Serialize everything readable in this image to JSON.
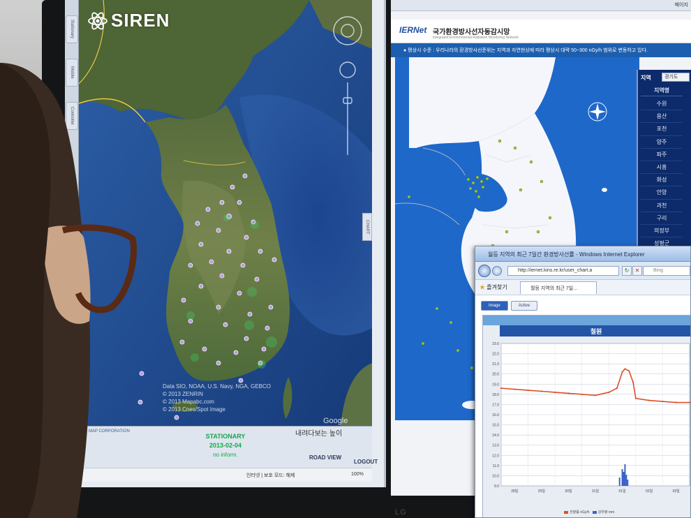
{
  "left_app": {
    "logo": "SIREN",
    "side_tabs": [
      "Stationary",
      "Mobile",
      "Controller"
    ],
    "chart_tab": "CHART",
    "map_credits": [
      "Data SIO, NOAA, U.S. Navy, NGA, GEBCO",
      "© 2013 ZENRIN",
      "© 2013 Mapabc.com",
      "© 2013 Cnes/Spot Image"
    ],
    "map_corner_text": "내려다보는 높이",
    "map_corp": "MAP CORPORATION",
    "status": {
      "title": "STATIONARY",
      "date": "2013-02-04",
      "info": "no inform."
    },
    "road_view": "ROAD VIEW",
    "logout": "LOGOUT",
    "ie_status": {
      "zone": "인터넷 | 보호 모드: 해제",
      "zoom": "100%"
    }
  },
  "right_app": {
    "top_bar_tail": "페이지",
    "logo": "IERNet",
    "title": "국가환경방사선자동감시망",
    "title_en": "Integrated Environmental Radiation Monitoring Network",
    "notice": "● 평상시 수준 : 우리나라의 환경방사선준위는 지역과 자연현상에 따라 평상시 대략 50~300 nGy/h 범위로 변동하고 있다.",
    "region_panel": {
      "heading": "지역",
      "selected": "경기도",
      "column": "지역명",
      "regions": [
        "수원",
        "용산",
        "포천",
        "양주",
        "파주",
        "시흥",
        "화성",
        "안양",
        "과천",
        "구리",
        "의정부",
        "성평군"
      ]
    }
  },
  "ie_window": {
    "title": "월등 지역의 최근 7일간 환경방사선률 - Windows Internet Explorer",
    "url": "http://iernet.kins.re.kr/user_chart.a",
    "search": "Bing",
    "favorites": "즐겨찾기",
    "tab_label": "월등 지역의 최근 7일...",
    "page_tabs": [
      "Image",
      "Active"
    ],
    "chart_title": "철원"
  },
  "chart_data": {
    "type": "line",
    "title": "철원",
    "ylim": [
      9.0,
      23.0
    ],
    "ytick_labels": [
      "23.0",
      "22.0",
      "21.0",
      "20.0",
      "19.0",
      "18.0",
      "17.0",
      "16.0",
      "15.0",
      "14.0",
      "13.0",
      "12.0",
      "11.0",
      "10.0",
      "9.0"
    ],
    "xtick_labels": [
      "28일",
      "29일",
      "30일",
      "31일",
      "01일",
      "02일",
      "03일"
    ],
    "series": [
      {
        "name": "선량률 nGy/h",
        "color": "#d9502a",
        "x": [
          0,
          0.5,
          1,
          1.5,
          2,
          2.5,
          3,
          3.5,
          4,
          4.3,
          4.5,
          4.6,
          4.75,
          4.9,
          5,
          5.5,
          6,
          6.5,
          7
        ],
        "values": [
          18.6,
          18.5,
          18.4,
          18.3,
          18.2,
          18.1,
          18.0,
          17.9,
          18.2,
          18.6,
          20.2,
          20.5,
          20.3,
          19.2,
          17.6,
          17.4,
          17.3,
          17.2,
          17.2
        ]
      },
      {
        "name": "강우량 mm",
        "color": "#3a63c8",
        "bars": [
          {
            "x": 4.4,
            "values": 1.2
          },
          {
            "x": 4.5,
            "values": 2.4
          },
          {
            "x": 4.55,
            "values": 2.0
          },
          {
            "x": 4.6,
            "values": 3.1
          },
          {
            "x": 4.65,
            "values": 1.6
          },
          {
            "x": 4.7,
            "values": 0.9
          }
        ]
      }
    ]
  }
}
